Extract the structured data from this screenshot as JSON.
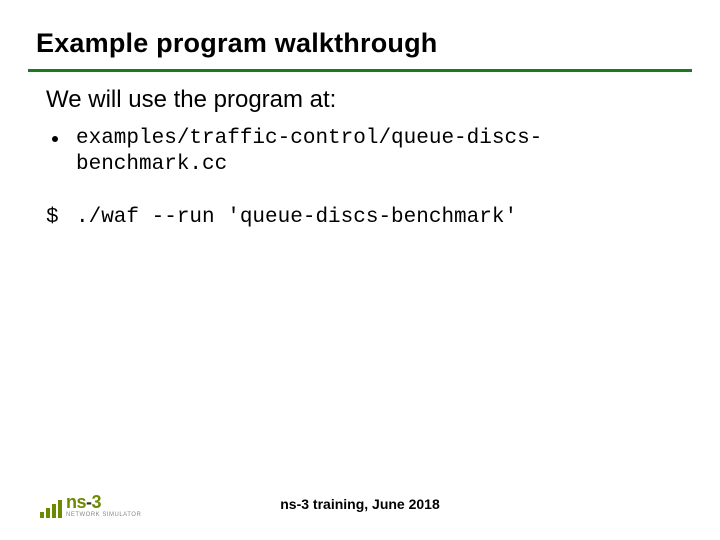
{
  "title": "Example program walkthrough",
  "lead": "We will use the program at:",
  "bullet_code": "examples/traffic-control/queue-discs-benchmark.cc",
  "cmd_prefix": "$",
  "cmd": "./waf --run 'queue-discs-benchmark'",
  "footer": "ns-3 training, June 2018",
  "logo": {
    "main_n": "ns",
    "main_dash": "-",
    "main_3": "3",
    "sub": "NETWORK SIMULATOR"
  }
}
